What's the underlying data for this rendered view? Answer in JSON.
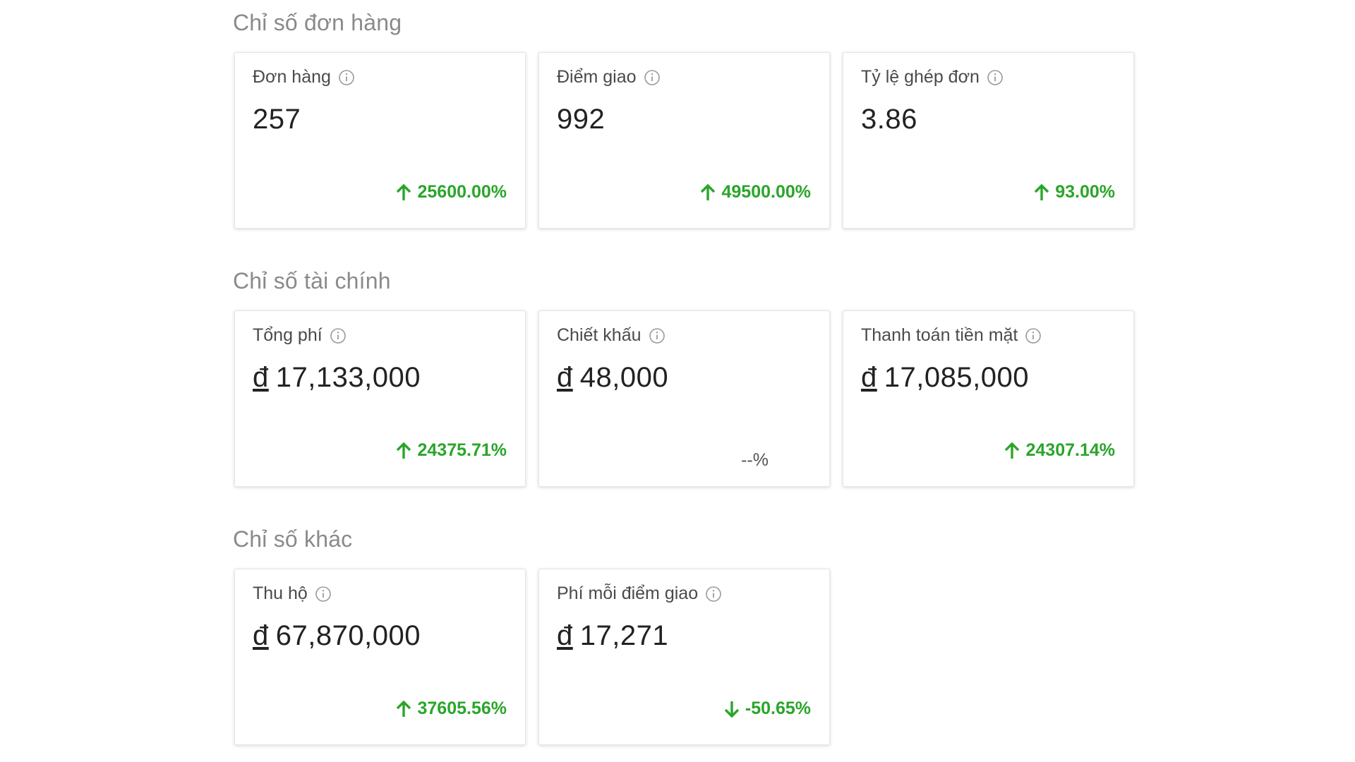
{
  "colors": {
    "positive": "#2aa52a",
    "neutral": "#555555",
    "section_title": "#8a8a8a"
  },
  "sections": [
    {
      "title": "Chỉ số đơn hàng",
      "cards": [
        {
          "label": "Đơn hàng",
          "currency": "",
          "value": "257",
          "change": "25600.00%",
          "trend": "up",
          "icon": "arrow-up-icon"
        },
        {
          "label": "Điểm giao",
          "currency": "",
          "value": "992",
          "change": "49500.00%",
          "trend": "up",
          "icon": "arrow-up-icon"
        },
        {
          "label": "Tỷ lệ ghép đơn",
          "currency": "",
          "value": "3.86",
          "change": "93.00%",
          "trend": "up",
          "icon": "arrow-up-icon"
        }
      ]
    },
    {
      "title": "Chỉ số tài chính",
      "cards": [
        {
          "label": "Tổng phí",
          "currency": "đ",
          "value": "17,133,000",
          "change": "24375.71%",
          "trend": "up",
          "icon": "arrow-up-icon"
        },
        {
          "label": "Chiết khấu",
          "currency": "đ",
          "value": "48,000",
          "change": "--%",
          "trend": "neutral",
          "icon": ""
        },
        {
          "label": "Thanh toán tiền mặt",
          "currency": "đ",
          "value": "17,085,000",
          "change": "24307.14%",
          "trend": "up",
          "icon": "arrow-up-icon"
        }
      ]
    },
    {
      "title": "Chỉ số khác",
      "cards": [
        {
          "label": "Thu hộ",
          "currency": "đ",
          "value": "67,870,000",
          "change": "37605.56%",
          "trend": "up",
          "icon": "arrow-up-icon"
        },
        {
          "label": "Phí mỗi điểm giao",
          "currency": "đ",
          "value": "17,271",
          "change": "-50.65%",
          "trend": "down",
          "icon": "arrow-down-icon"
        }
      ]
    }
  ]
}
